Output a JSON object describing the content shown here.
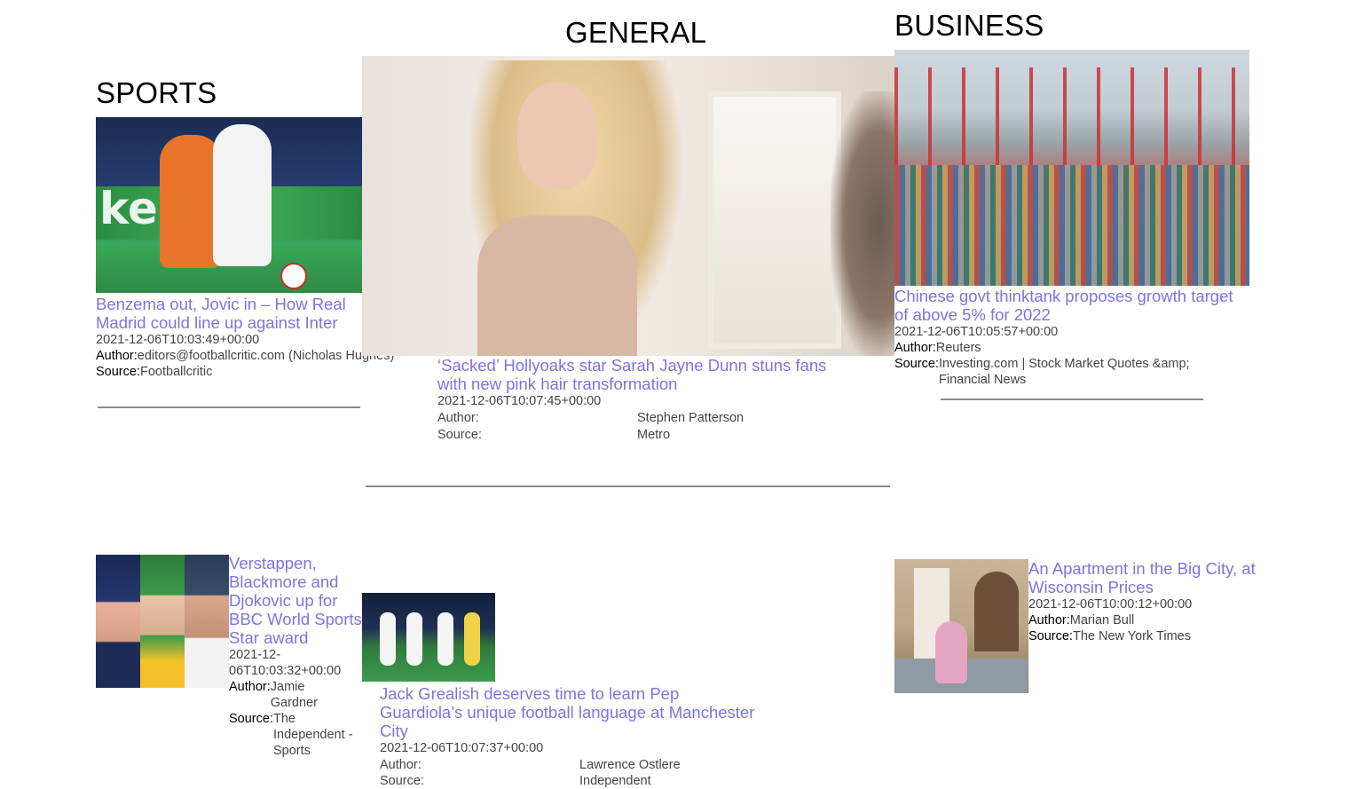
{
  "sections": {
    "sports": {
      "heading": "SPORTS",
      "articles": [
        {
          "title": "Benzema out, Jovic in – How Real Madrid could line up against Inter",
          "published": "2021-12-06T10:03:49+00:00",
          "author_label": "Author:",
          "author": "editors@footballcritic.com (Nicholas Hughes)",
          "source_label": "Source:",
          "source": "Footballcritic"
        },
        {
          "title": "Verstappen, Blackmore and Djokovic up for BBC World Sports Star award",
          "published": "2021-12-06T10:03:32+00:00",
          "author_label": "Author:",
          "author": "Jamie Gardner",
          "source_label": "Source:",
          "source": "The Independent - Sports"
        }
      ]
    },
    "general": {
      "heading": "GENERAL",
      "articles": [
        {
          "title": "‘Sacked’ Hollyoaks star Sarah Jayne Dunn stuns fans with new pink hair transformation",
          "published": "2021-12-06T10:07:45+00:00",
          "author_label": "Author:",
          "author": "Stephen Patterson",
          "source_label": "Source:",
          "source": "Metro"
        },
        {
          "title": "Jack Grealish deserves time to learn Pep Guardiola’s unique football language at Manchester City",
          "published": "2021-12-06T10:07:37+00:00",
          "author_label": "Author:",
          "author": "Lawrence Ostlere",
          "source_label": "Source:",
          "source": "Independent"
        }
      ]
    },
    "business": {
      "heading": "BUSINESS",
      "articles": [
        {
          "title": "Chinese govt thinktank proposes growth target of above 5% for 2022",
          "published": "2021-12-06T10:05:57+00:00",
          "author_label": "Author:",
          "author": "Reuters",
          "source_label": "Source:",
          "source": "Investing.com | Stock Market Quotes &amp; Financial News"
        },
        {
          "title": "An Apartment in the Big City, at Wisconsin Prices",
          "published": "2021-12-06T10:00:12+00:00",
          "author_label": "Author:",
          "author": "Marian Bull",
          "source_label": "Source:",
          "source": "The New York Times"
        }
      ]
    }
  },
  "colors": {
    "headline": "#7b74e0",
    "rule": "#8a8a8a"
  }
}
